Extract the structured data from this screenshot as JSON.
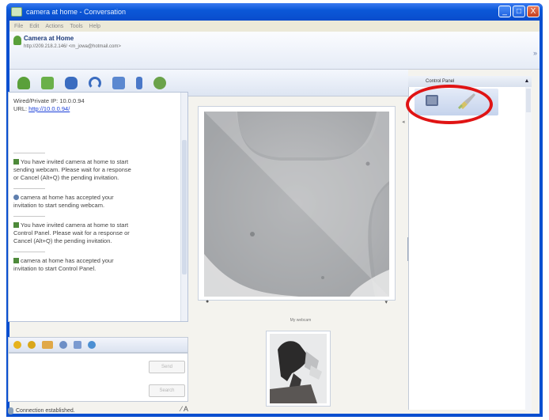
{
  "window": {
    "title": "camera at home - Conversation",
    "min_label": "_",
    "max_label": "□",
    "close_label": "X"
  },
  "menu": [
    "File",
    "Edit",
    "Actions",
    "Tools",
    "Help"
  ],
  "contact": {
    "name": "Camera at Home",
    "email": "http://209.218.2.146/ <m_jowa@hotmail.com>"
  },
  "chat": {
    "lines": [
      "Wired/Private IP: 10.0.0.94",
      "URL: http://10.0.0.94/"
    ],
    "url_prefix": "URL: ",
    "url_text": "http://10.0.0.94/",
    "messages": [
      [
        "You have invited camera at home to start",
        "sending webcam. Please wait for a response",
        "or Cancel (Alt+Q) the pending invitation."
      ],
      [
        "camera at home has accepted your",
        "invitation to start sending webcam."
      ],
      [
        "You have invited camera at home to start",
        "Control Panel. Please wait for a response or",
        "Cancel (Alt+Q) the pending invitation."
      ],
      [
        "camera at home has accepted your",
        "invitation to start Control Panel."
      ]
    ]
  },
  "compose": {
    "send_label": "Send",
    "search_label": "Search"
  },
  "status": {
    "text": "Connection established.",
    "tools": "⁄ A"
  },
  "video": {
    "preview_label": "My webcam"
  },
  "control_panel": {
    "title": "Control Panel",
    "collapse": "▲"
  },
  "colors": {
    "titlebar": "#0b58d8",
    "highlight_ring": "#e01414",
    "link": "#1a3ed8"
  },
  "icons": {
    "toolbar": [
      "invite-icon",
      "send-files-icon",
      "webcam-icon",
      "call-icon",
      "share-icon",
      "block-icon",
      "activities-icon"
    ],
    "compose": [
      "emoticon-icon",
      "wink-icon",
      "nudge-icon",
      "voice-clip-icon",
      "font-icon",
      "backgrounds-icon"
    ],
    "control_panel": [
      "settings-icon",
      "brush-icon"
    ]
  }
}
